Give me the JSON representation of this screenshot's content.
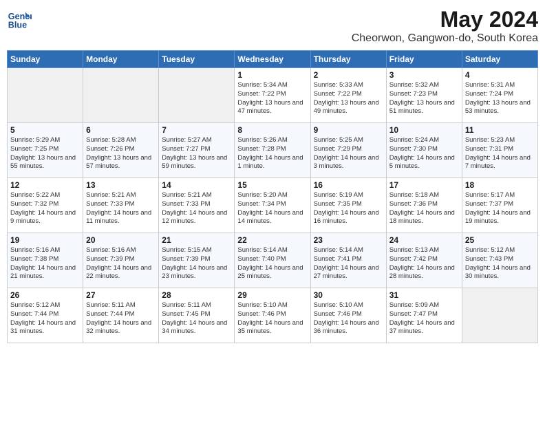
{
  "header": {
    "logo_line1": "General",
    "logo_line2": "Blue",
    "month": "May 2024",
    "location": "Cheorwon, Gangwon-do, South Korea"
  },
  "days_of_week": [
    "Sunday",
    "Monday",
    "Tuesday",
    "Wednesday",
    "Thursday",
    "Friday",
    "Saturday"
  ],
  "weeks": [
    [
      {
        "day": "",
        "empty": true
      },
      {
        "day": "",
        "empty": true
      },
      {
        "day": "",
        "empty": true
      },
      {
        "day": "1",
        "sunrise": "5:34 AM",
        "sunset": "7:22 PM",
        "daylight": "13 hours and 47 minutes."
      },
      {
        "day": "2",
        "sunrise": "5:33 AM",
        "sunset": "7:22 PM",
        "daylight": "13 hours and 49 minutes."
      },
      {
        "day": "3",
        "sunrise": "5:32 AM",
        "sunset": "7:23 PM",
        "daylight": "13 hours and 51 minutes."
      },
      {
        "day": "4",
        "sunrise": "5:31 AM",
        "sunset": "7:24 PM",
        "daylight": "13 hours and 53 minutes."
      }
    ],
    [
      {
        "day": "5",
        "sunrise": "5:29 AM",
        "sunset": "7:25 PM",
        "daylight": "13 hours and 55 minutes."
      },
      {
        "day": "6",
        "sunrise": "5:28 AM",
        "sunset": "7:26 PM",
        "daylight": "13 hours and 57 minutes."
      },
      {
        "day": "7",
        "sunrise": "5:27 AM",
        "sunset": "7:27 PM",
        "daylight": "13 hours and 59 minutes."
      },
      {
        "day": "8",
        "sunrise": "5:26 AM",
        "sunset": "7:28 PM",
        "daylight": "14 hours and 1 minute."
      },
      {
        "day": "9",
        "sunrise": "5:25 AM",
        "sunset": "7:29 PM",
        "daylight": "14 hours and 3 minutes."
      },
      {
        "day": "10",
        "sunrise": "5:24 AM",
        "sunset": "7:30 PM",
        "daylight": "14 hours and 5 minutes."
      },
      {
        "day": "11",
        "sunrise": "5:23 AM",
        "sunset": "7:31 PM",
        "daylight": "14 hours and 7 minutes."
      }
    ],
    [
      {
        "day": "12",
        "sunrise": "5:22 AM",
        "sunset": "7:32 PM",
        "daylight": "14 hours and 9 minutes."
      },
      {
        "day": "13",
        "sunrise": "5:21 AM",
        "sunset": "7:33 PM",
        "daylight": "14 hours and 11 minutes."
      },
      {
        "day": "14",
        "sunrise": "5:21 AM",
        "sunset": "7:33 PM",
        "daylight": "14 hours and 12 minutes."
      },
      {
        "day": "15",
        "sunrise": "5:20 AM",
        "sunset": "7:34 PM",
        "daylight": "14 hours and 14 minutes."
      },
      {
        "day": "16",
        "sunrise": "5:19 AM",
        "sunset": "7:35 PM",
        "daylight": "14 hours and 16 minutes."
      },
      {
        "day": "17",
        "sunrise": "5:18 AM",
        "sunset": "7:36 PM",
        "daylight": "14 hours and 18 minutes."
      },
      {
        "day": "18",
        "sunrise": "5:17 AM",
        "sunset": "7:37 PM",
        "daylight": "14 hours and 19 minutes."
      }
    ],
    [
      {
        "day": "19",
        "sunrise": "5:16 AM",
        "sunset": "7:38 PM",
        "daylight": "14 hours and 21 minutes."
      },
      {
        "day": "20",
        "sunrise": "5:16 AM",
        "sunset": "7:39 PM",
        "daylight": "14 hours and 22 minutes."
      },
      {
        "day": "21",
        "sunrise": "5:15 AM",
        "sunset": "7:39 PM",
        "daylight": "14 hours and 23 minutes."
      },
      {
        "day": "22",
        "sunrise": "5:14 AM",
        "sunset": "7:40 PM",
        "daylight": "14 hours and 25 minutes."
      },
      {
        "day": "23",
        "sunrise": "5:14 AM",
        "sunset": "7:41 PM",
        "daylight": "14 hours and 27 minutes."
      },
      {
        "day": "24",
        "sunrise": "5:13 AM",
        "sunset": "7:42 PM",
        "daylight": "14 hours and 28 minutes."
      },
      {
        "day": "25",
        "sunrise": "5:12 AM",
        "sunset": "7:43 PM",
        "daylight": "14 hours and 30 minutes."
      }
    ],
    [
      {
        "day": "26",
        "sunrise": "5:12 AM",
        "sunset": "7:44 PM",
        "daylight": "14 hours and 31 minutes."
      },
      {
        "day": "27",
        "sunrise": "5:11 AM",
        "sunset": "7:44 PM",
        "daylight": "14 hours and 32 minutes."
      },
      {
        "day": "28",
        "sunrise": "5:11 AM",
        "sunset": "7:45 PM",
        "daylight": "14 hours and 34 minutes."
      },
      {
        "day": "29",
        "sunrise": "5:10 AM",
        "sunset": "7:46 PM",
        "daylight": "14 hours and 35 minutes."
      },
      {
        "day": "30",
        "sunrise": "5:10 AM",
        "sunset": "7:46 PM",
        "daylight": "14 hours and 36 minutes."
      },
      {
        "day": "31",
        "sunrise": "5:09 AM",
        "sunset": "7:47 PM",
        "daylight": "14 hours and 37 minutes."
      },
      {
        "day": "",
        "empty": true
      }
    ]
  ],
  "labels": {
    "sunrise": "Sunrise:",
    "sunset": "Sunset:",
    "daylight": "Daylight:"
  }
}
